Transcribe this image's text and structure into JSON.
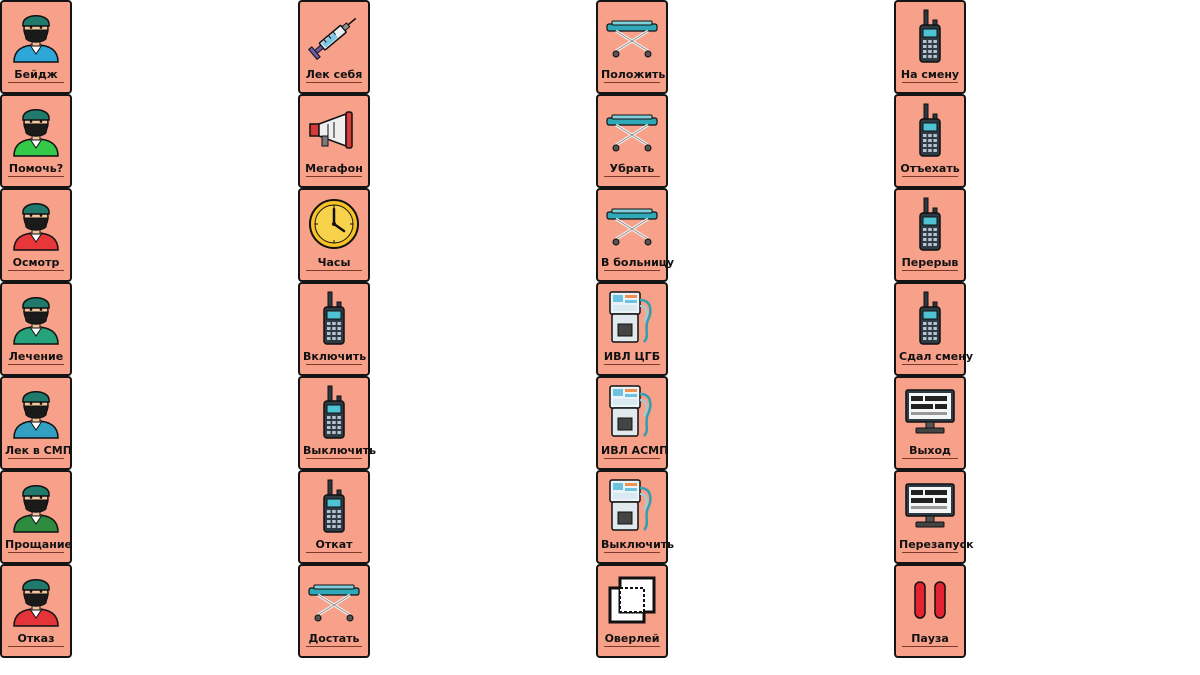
{
  "columns": [
    {
      "tiles": [
        {
          "label": "Бейдж",
          "icon": "doctor-icon",
          "color": "#2fa6d8"
        },
        {
          "label": "Помочь?",
          "icon": "doctor-icon",
          "color": "#35c94a"
        },
        {
          "label": "Осмотр",
          "icon": "doctor-icon",
          "color": "#e8373a"
        },
        {
          "label": "Лечение",
          "icon": "doctor-icon",
          "color": "#26a37a"
        },
        {
          "label": "Лек в СМП",
          "icon": "doctor-icon",
          "color": "#33a0c2"
        },
        {
          "label": "Прощание",
          "icon": "doctor-icon",
          "color": "#2e8b3e"
        },
        {
          "label": "Отказ",
          "icon": "doctor-icon",
          "color": "#e4343a"
        }
      ]
    },
    {
      "tiles": [
        {
          "label": "Лек себя",
          "icon": "syringe-icon"
        },
        {
          "label": "Мегафон",
          "icon": "megaphone-icon"
        },
        {
          "label": "Часы",
          "icon": "clock-icon"
        },
        {
          "label": "Включить",
          "icon": "radio-icon"
        },
        {
          "label": "Выключить",
          "icon": "radio-icon"
        },
        {
          "label": "Откат",
          "icon": "radio-icon"
        },
        {
          "label": "Достать",
          "icon": "stretcher-icon"
        }
      ]
    },
    {
      "tiles": [
        {
          "label": "Положить",
          "icon": "stretcher-icon"
        },
        {
          "label": "Убрать",
          "icon": "stretcher-icon"
        },
        {
          "label": "В больницу",
          "icon": "stretcher-icon"
        },
        {
          "label": "ИВЛ ЦГБ",
          "icon": "ventilator-icon"
        },
        {
          "label": "ИВЛ АСМП",
          "icon": "ventilator-icon"
        },
        {
          "label": "Выключить",
          "icon": "ventilator-icon"
        },
        {
          "label": "Оверлей",
          "icon": "overlay-icon"
        }
      ]
    },
    {
      "tiles": [
        {
          "label": "На смену",
          "icon": "radio-icon"
        },
        {
          "label": "Отъехать",
          "icon": "radio-icon"
        },
        {
          "label": "Перерыв",
          "icon": "radio-icon"
        },
        {
          "label": "Сдал смену",
          "icon": "radio-icon"
        },
        {
          "label": "Выход",
          "icon": "monitor-code-icon"
        },
        {
          "label": "Перезапуск",
          "icon": "monitor-code-icon"
        },
        {
          "label": "Пауза",
          "icon": "pause-icon"
        }
      ]
    }
  ],
  "colors": {
    "tile_bg": "#f7a08a",
    "tile_border": "#141414",
    "page_bg": "#ffffff"
  }
}
